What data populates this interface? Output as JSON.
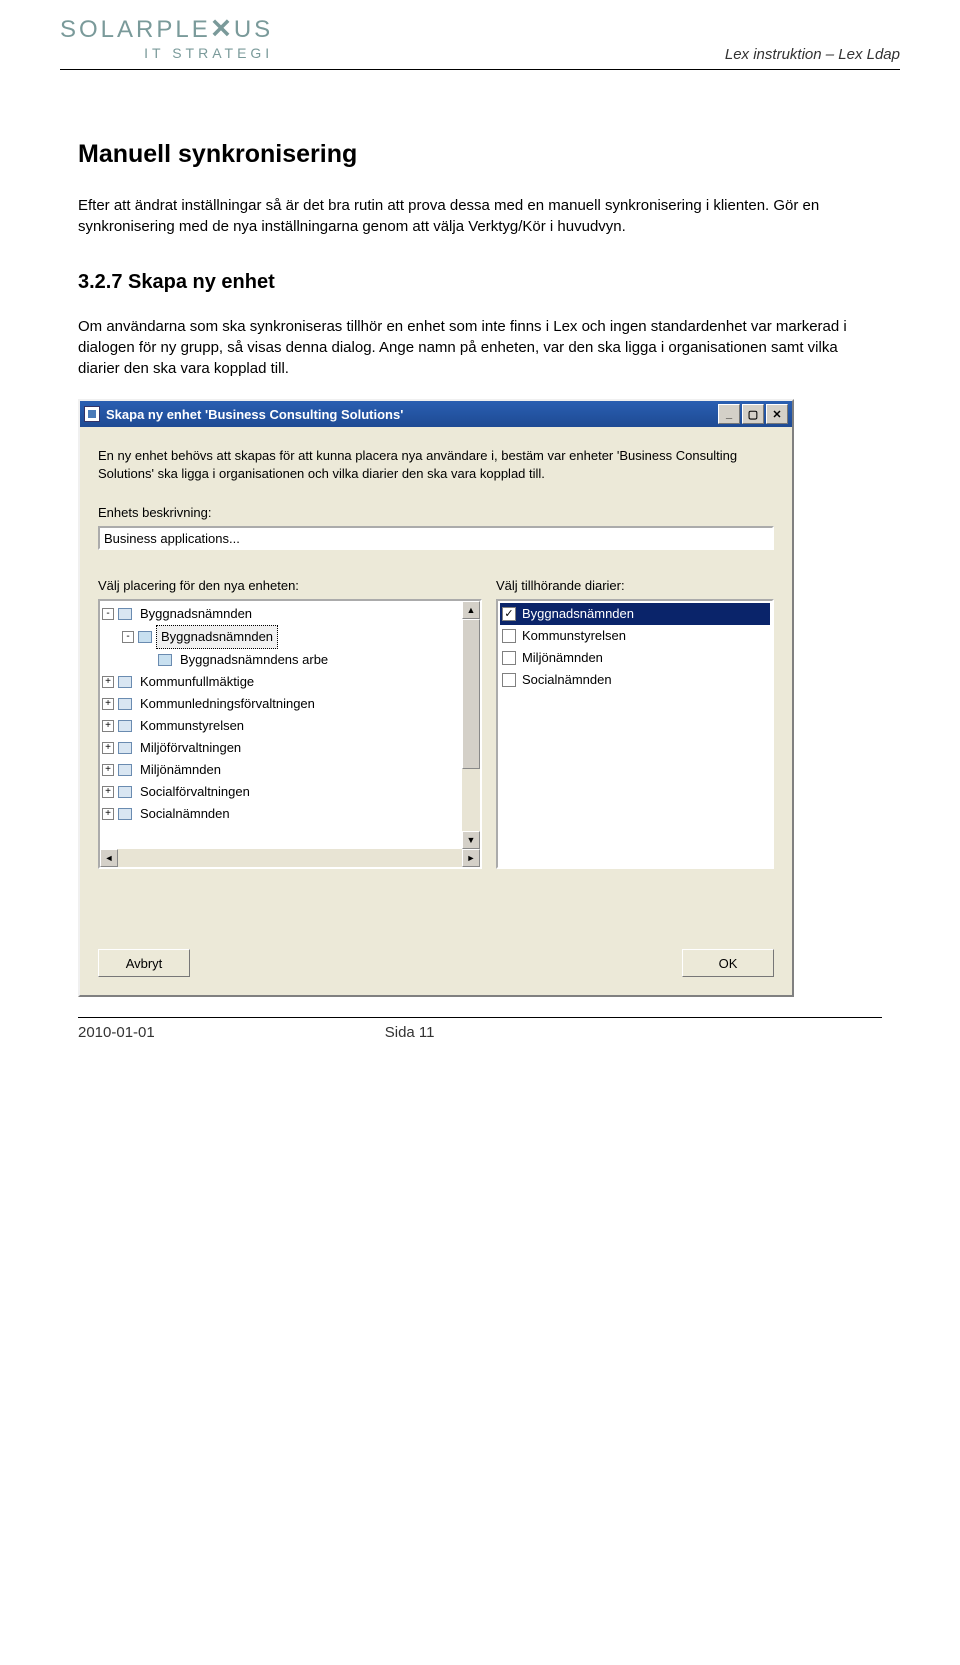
{
  "header": {
    "logo_main_pre": "SOLARPLE",
    "logo_main_post": "US",
    "logo_sub": "IT STRATEGI",
    "right": "Lex instruktion – Lex Ldap"
  },
  "content": {
    "h1": "Manuell synkronisering",
    "p1": "Efter att ändrat inställningar så är det bra rutin att prova dessa med en manuell synkronisering i klienten. Gör en synkronisering med de nya inställningarna genom att välja Verktyg/Kör i huvudvyn.",
    "h2": "3.2.7  Skapa ny enhet",
    "p2": "Om användarna som ska synkroniseras tillhör en enhet som inte finns i Lex och ingen standardenhet var markerad i dialogen för ny grupp, så visas denna dialog. Ange namn på enheten, var den ska ligga i organisationen samt vilka diarier den ska vara kopplad till."
  },
  "dialog": {
    "title": "Skapa ny enhet 'Business Consulting Solutions'",
    "intro": "En ny enhet behövs att skapas för att kunna placera nya användare i, bestäm var enheter 'Business Consulting Solutions' ska ligga i organisationen och vilka diarier den ska vara kopplad till.",
    "desc_label": "Enhets beskrivning:",
    "desc_value": "Business applications...",
    "place_label": "Välj placering för den nya enheten:",
    "diary_label": "Välj tillhörande diarier:",
    "tree": [
      {
        "indent": 0,
        "expander": "-",
        "icon": "org",
        "label": "Byggnadsnämnden",
        "selected": false
      },
      {
        "indent": 1,
        "expander": "-",
        "icon": "folder",
        "label": "Byggnadsnämnden",
        "selected": true
      },
      {
        "indent": 2,
        "expander": "",
        "icon": "folder",
        "label": "Byggnadsnämndens arbe",
        "selected": false
      },
      {
        "indent": 0,
        "expander": "+",
        "icon": "org",
        "label": "Kommunfullmäktige",
        "selected": false
      },
      {
        "indent": 0,
        "expander": "+",
        "icon": "org",
        "label": "Kommunledningsförvaltningen",
        "selected": false
      },
      {
        "indent": 0,
        "expander": "+",
        "icon": "org",
        "label": "Kommunstyrelsen",
        "selected": false
      },
      {
        "indent": 0,
        "expander": "+",
        "icon": "org",
        "label": "Miljöförvaltningen",
        "selected": false
      },
      {
        "indent": 0,
        "expander": "+",
        "icon": "org",
        "label": "Miljönämnden",
        "selected": false
      },
      {
        "indent": 0,
        "expander": "+",
        "icon": "org",
        "label": "Socialförvaltningen",
        "selected": false
      },
      {
        "indent": 0,
        "expander": "+",
        "icon": "org",
        "label": "Socialnämnden",
        "selected": false
      }
    ],
    "diaries": [
      {
        "label": "Byggnadsnämnden",
        "checked": true,
        "selected": true
      },
      {
        "label": "Kommunstyrelsen",
        "checked": false,
        "selected": false
      },
      {
        "label": "Miljönämnden",
        "checked": false,
        "selected": false
      },
      {
        "label": "Socialnämnden",
        "checked": false,
        "selected": false
      }
    ],
    "cancel": "Avbryt",
    "ok": "OK"
  },
  "footer": {
    "date": "2010-01-01",
    "page": "Sida 11"
  }
}
